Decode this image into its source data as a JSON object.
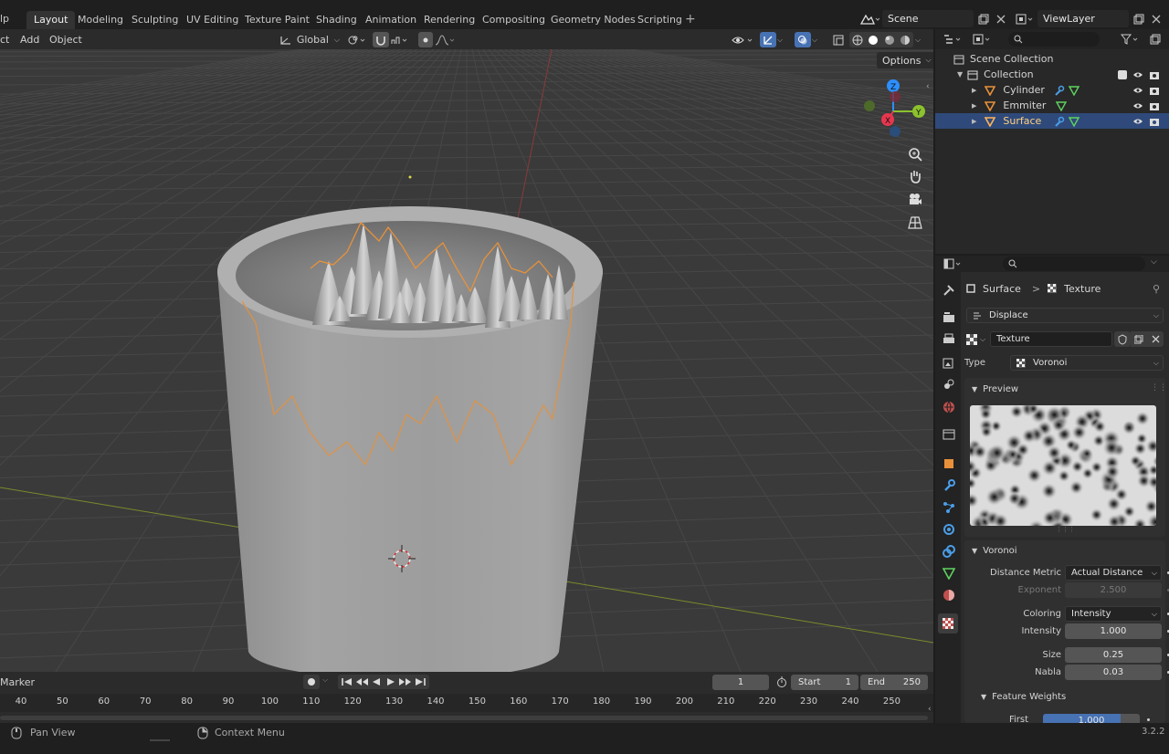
{
  "topbar": {
    "help_menu": "lp",
    "workspaces": [
      "Layout",
      "Modeling",
      "Sculpting",
      "UV Editing",
      "Texture Paint",
      "Shading",
      "Animation",
      "Rendering",
      "Compositing",
      "Geometry Nodes",
      "Scripting"
    ],
    "active_workspace": "Layout",
    "add_workspace": "+",
    "scene": "Scene",
    "view_layer": "ViewLayer"
  },
  "viewport_header": {
    "menus": [
      "ct",
      "Add",
      "Object"
    ],
    "orientation": "Global",
    "options": "Options"
  },
  "outliner": {
    "root": "Scene Collection",
    "collection": "Collection",
    "objects": [
      {
        "name": "Cylinder",
        "selected": false
      },
      {
        "name": "Emmiter",
        "selected": false
      },
      {
        "name": "Surface",
        "selected": true
      }
    ]
  },
  "properties": {
    "breadcrumb_object": "Surface",
    "breadcrumb_sep": ">",
    "breadcrumb_texture": "Texture",
    "modifier": "Displace",
    "texture_name": "Texture",
    "type_label": "Type",
    "type_value": "Voronoi",
    "preview_label": "Preview",
    "voronoi_label": "Voronoi",
    "fields": [
      {
        "label": "Distance Metric",
        "value": "Actual Distance",
        "kind": "dropdown"
      },
      {
        "label": "Exponent",
        "value": "2.500",
        "kind": "disabled"
      },
      {
        "label": "Coloring",
        "value": "Intensity",
        "kind": "dropdown"
      },
      {
        "label": "Intensity",
        "value": "1.000",
        "kind": "number"
      },
      {
        "label": "Size",
        "value": "0.25",
        "kind": "number"
      },
      {
        "label": "Nabla",
        "value": "0.03",
        "kind": "number"
      }
    ],
    "feature_weights_label": "Feature Weights",
    "first_label": "First",
    "first_value": "1.000",
    "first_fill": 0.8
  },
  "timeline": {
    "marker_menu": "Marker",
    "current_frame": "1",
    "start_label": "Start",
    "start_value": "1",
    "end_label": "End",
    "end_value": "250",
    "ticks": [
      "40",
      "50",
      "60",
      "70",
      "80",
      "90",
      "100",
      "110",
      "120",
      "130",
      "140",
      "150",
      "160",
      "170",
      "180",
      "190",
      "200",
      "210",
      "220",
      "230",
      "240",
      "250"
    ]
  },
  "statusbar": {
    "pan_view": "Pan View",
    "context_menu": "Context Menu",
    "version": "3.2.2"
  },
  "colors": {
    "accent": "#4772b3",
    "selection_outline": "#e8913a",
    "axis_x": "#e8364f",
    "axis_y": "#8bc22d",
    "axis_z": "#2c8fff"
  }
}
